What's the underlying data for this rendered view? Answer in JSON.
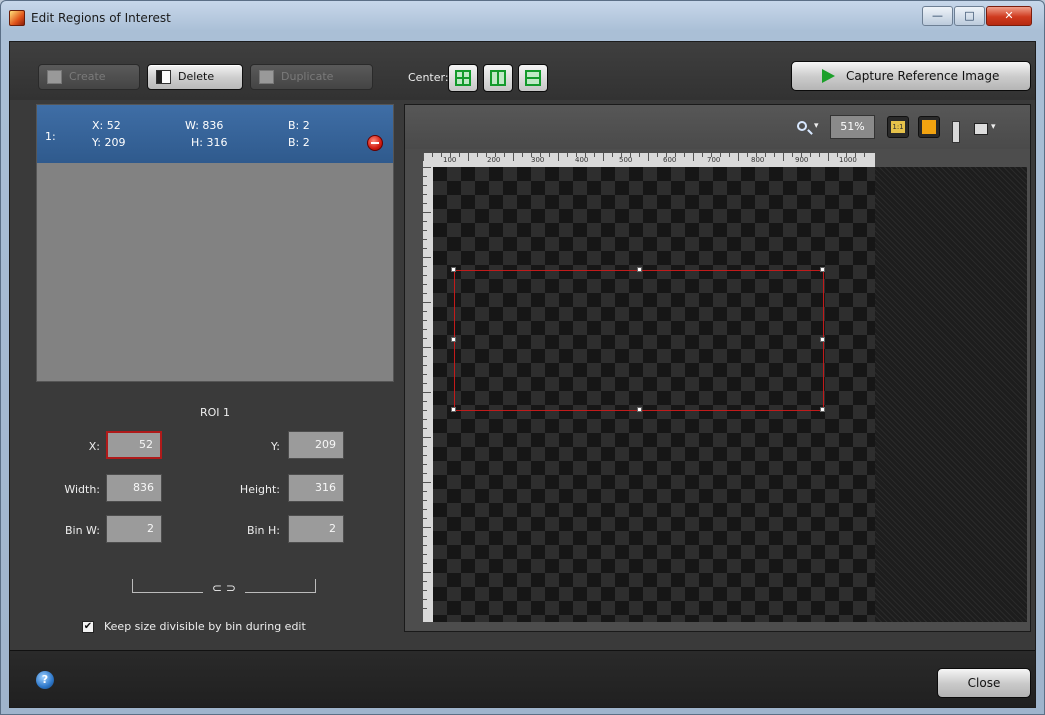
{
  "window": {
    "title": "Edit Regions of Interest",
    "minimize": "—",
    "maximize": "□",
    "close": "✕"
  },
  "toolbar": {
    "create_label": "Create",
    "delete_label": "Delete",
    "duplicate_label": "Duplicate",
    "center_label": "Center:",
    "capture_label": "Capture Reference Image"
  },
  "roi_list": {
    "items": [
      {
        "index": "1:",
        "x": "X: 52",
        "y": "Y: 209",
        "w": "W: 836",
        "h": "H: 316",
        "b1": "B: 2",
        "b2": "B: 2"
      }
    ]
  },
  "roi_editor": {
    "title": "ROI 1",
    "x_label": "X:",
    "x_value": "52",
    "y_label": "Y:",
    "y_value": "209",
    "width_label": "Width:",
    "width_value": "836",
    "height_label": "Height:",
    "height_value": "316",
    "binw_label": "Bin W:",
    "binw_value": "2",
    "binh_label": "Bin H:",
    "binh_value": "2",
    "link_symbol": "⊂ ⊃",
    "keep_divisible_label": "Keep size divisible by bin during edit",
    "keep_divisible_checked": true
  },
  "viewer": {
    "zoom_value": "51%",
    "zoom_actual_label": "1:1",
    "ruler_labels": [
      "100",
      "200",
      "300",
      "400",
      "500",
      "600",
      "700",
      "800",
      "900",
      "1000"
    ]
  },
  "footer": {
    "help": "?",
    "close_label": "Close"
  }
}
